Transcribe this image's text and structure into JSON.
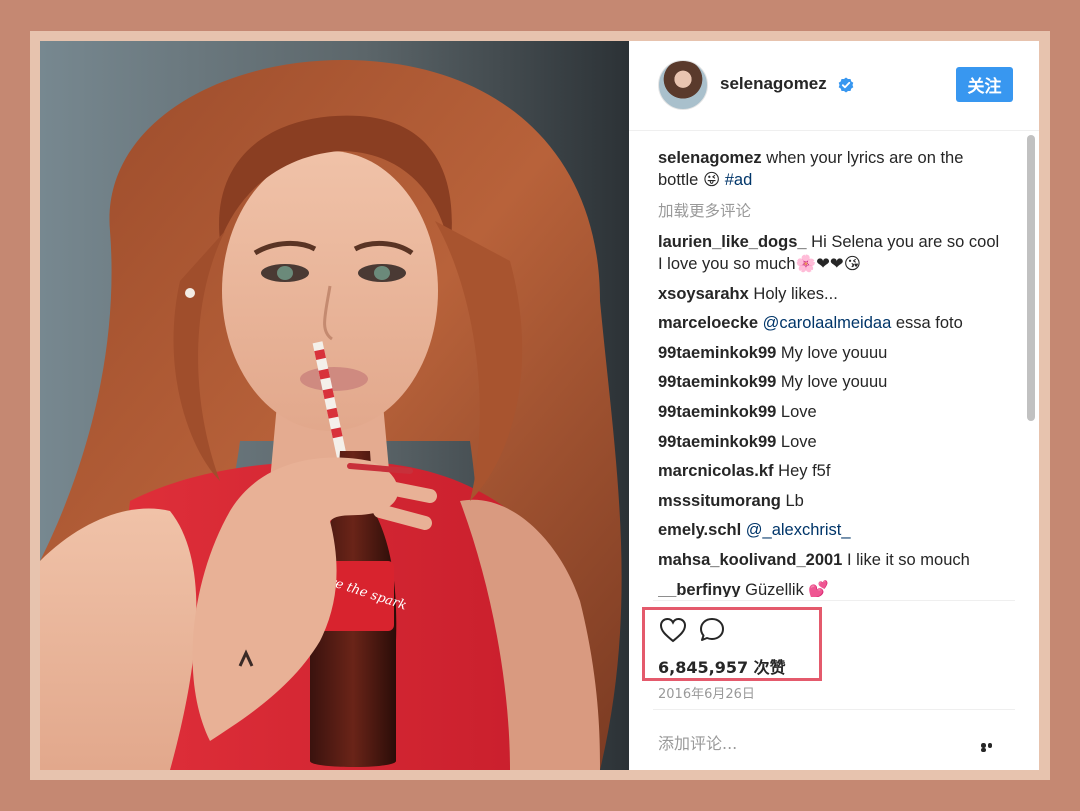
{
  "post": {
    "username": "selenagomez",
    "follow_label": "关注",
    "caption": {
      "user": "selenagomez",
      "text": "when your lyrics are on the bottle 😜 ",
      "hashtag": "#ad"
    },
    "load_more": "加载更多评论",
    "comments": [
      {
        "user": "laurien_like_dogs_",
        "text": "Hi Selena you are so cool I love you so much🌸❤❤😘"
      },
      {
        "user": "xsoysarahx",
        "text": "Holy likes..."
      },
      {
        "user": "marceloecke",
        "mention": "@carolaalmeidaa",
        "text": "essa foto"
      },
      {
        "user": "99taeminkok99",
        "text": "My love youuu"
      },
      {
        "user": "99taeminkok99",
        "text": "My love youuu"
      },
      {
        "user": "99taeminkok99",
        "text": "Love"
      },
      {
        "user": "99taeminkok99",
        "text": "Love"
      },
      {
        "user": "marcnicolas.kf",
        "text": "Hey f5f"
      },
      {
        "user": "msssitumorang",
        "text": "Lb"
      },
      {
        "user": "emely.schl",
        "mention": "@_alexchrist_",
        "text": ""
      },
      {
        "user": "mahsa_koolivand_2001",
        "text": "I like it so mouch"
      },
      {
        "user": "__berfinyy",
        "text": "Güzellik 💕"
      }
    ],
    "likes": "6,845,957 次赞",
    "date": "2016年6月26日",
    "add_comment_placeholder": "添加评论...",
    "bottle_text": "You're the spark"
  },
  "icons": {
    "verified": "verified-badge-icon",
    "like": "heart-icon",
    "comment": "comment-bubble-icon",
    "more": "more-options-icon"
  },
  "colors": {
    "background": "#c58872",
    "frame": "#e7c3ae",
    "accent": "#3897f0",
    "mention": "#003569",
    "highlight": "#e45a6c"
  }
}
